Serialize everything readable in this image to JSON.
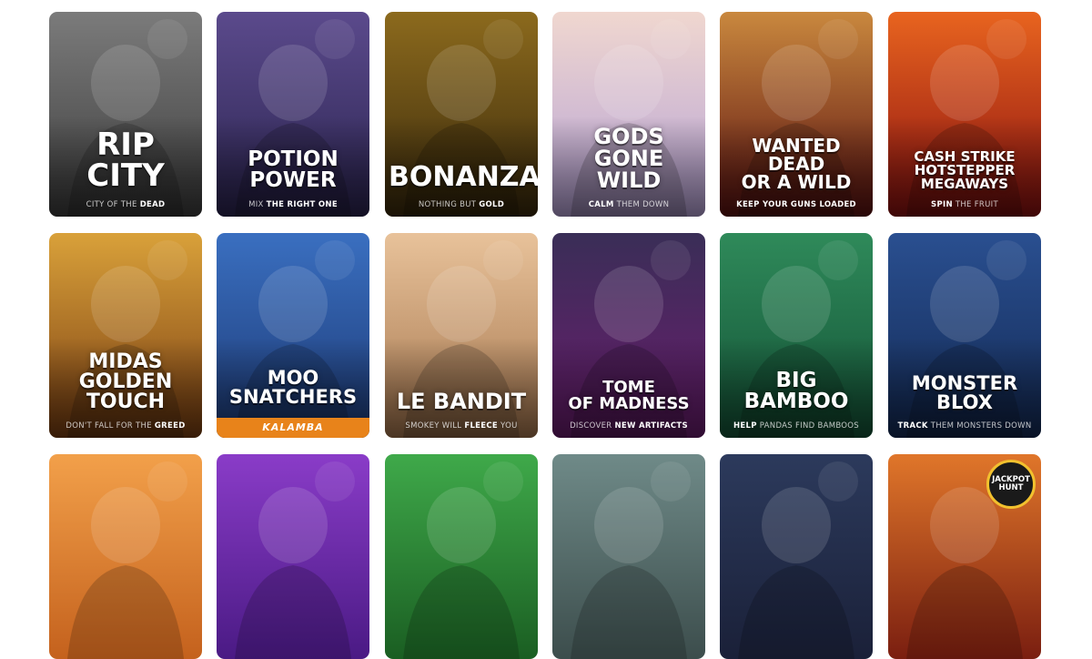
{
  "games": [
    {
      "title_lines": [
        "RIP CITY"
      ],
      "sub_pre": "CITY OF THE ",
      "sub_bold": "DEAD",
      "sub_post": "",
      "bg_top": "#7b7b7b",
      "bg_bottom": "#3d3d3d",
      "title_size": 34
    },
    {
      "title_lines": [
        "POTION POWER"
      ],
      "sub_pre": "MIX ",
      "sub_bold": "THE RIGHT ONE",
      "sub_post": "",
      "bg_top": "#5b4a8c",
      "bg_bottom": "#2b2450",
      "title_size": 23
    },
    {
      "title_lines": [
        "BONANZA"
      ],
      "sub_pre": "NOTHING BUT ",
      "sub_bold": "GOLD",
      "sub_post": "",
      "bg_top": "#8c6a1d",
      "bg_bottom": "#3a2a0c",
      "title_size": 30
    },
    {
      "title_lines": [
        "GODS GONE",
        "WILD"
      ],
      "sub_pre": "",
      "sub_bold": "CALM",
      "sub_post": " THEM DOWN",
      "bg_top": "#f0d7cf",
      "bg_bottom": "#b5a1d6",
      "title_size": 24
    },
    {
      "title_lines": [
        "WANTED DEAD",
        "OR A WILD"
      ],
      "sub_pre": "",
      "sub_bold": "KEEP YOUR GUNS LOADED",
      "sub_post": "",
      "bg_top": "#c9883e",
      "bg_bottom": "#5a1010",
      "title_size": 20
    },
    {
      "title_lines": [
        "CASH STRIKE",
        "HOTSTEPPER MEGAWAYS"
      ],
      "sub_pre": "",
      "sub_bold": "SPIN",
      "sub_post": " THE FRUIT",
      "bg_top": "#e8641f",
      "bg_bottom": "#8a1010",
      "title_size": 15
    },
    {
      "title_lines": [
        "MIDAS",
        "GOLDEN TOUCH"
      ],
      "sub_pre": "DON'T FALL FOR THE ",
      "sub_bold": "GREED",
      "sub_post": "",
      "bg_top": "#d9a13a",
      "bg_bottom": "#7a3e12",
      "title_size": 22
    },
    {
      "title_lines": [
        "MOO",
        "SNATCHERS"
      ],
      "sub_pre": "",
      "sub_bold": "",
      "sub_post": "",
      "logo_text": "KALAMBA",
      "bg_top": "#3a6fc0",
      "bg_bottom": "#1d3a76",
      "title_size": 21
    },
    {
      "title_lines": [
        "LE BANDIT"
      ],
      "sub_pre": "SMOKEY WILL ",
      "sub_bold": "FLEECE",
      "sub_post": " YOU",
      "bg_top": "#e8c29a",
      "bg_bottom": "#a5764e",
      "title_size": 24
    },
    {
      "title_lines": [
        "TOME",
        "OF MADNESS"
      ],
      "sub_pre": "DISCOVER ",
      "sub_bold": "NEW ARTIFACTS",
      "sub_post": "",
      "bg_top": "#3a2e57",
      "bg_bottom": "#6a1c6e",
      "title_size": 18
    },
    {
      "title_lines": [
        "BIG BAMBOO"
      ],
      "sub_pre": "",
      "sub_bold": "HELP",
      "sub_post": " PANDAS FIND BAMBOOS",
      "bg_top": "#2f8a5a",
      "bg_bottom": "#135236",
      "title_size": 23
    },
    {
      "title_lines": [
        "MONSTER BLOX"
      ],
      "sub_pre": "",
      "sub_bold": "TRACK",
      "sub_post": " THEM MONSTERS DOWN",
      "bg_top": "#2a4f90",
      "bg_bottom": "#132a55",
      "title_size": 21
    },
    {
      "title_lines": [],
      "sub_pre": "",
      "sub_bold": "",
      "sub_post": "",
      "bg_top": "#f2a04a",
      "bg_bottom": "#c4611d",
      "title_size": 20
    },
    {
      "title_lines": [],
      "sub_pre": "",
      "sub_bold": "",
      "sub_post": "",
      "bg_top": "#8a3cc8",
      "bg_bottom": "#4a1a84",
      "title_size": 20
    },
    {
      "title_lines": [],
      "sub_pre": "",
      "sub_bold": "",
      "sub_post": "",
      "bg_top": "#3fa94a",
      "bg_bottom": "#1a5e22",
      "title_size": 20
    },
    {
      "title_lines": [],
      "sub_pre": "",
      "sub_bold": "",
      "sub_post": "",
      "bg_top": "#6f8a88",
      "bg_bottom": "#3c4d4c",
      "title_size": 20
    },
    {
      "title_lines": [],
      "sub_pre": "",
      "sub_bold": "",
      "sub_post": "",
      "bg_top": "#2c3a5c",
      "bg_bottom": "#1a2038",
      "title_size": 20
    },
    {
      "title_lines": [],
      "badge_lines": [
        "JACKPOT",
        "HUNT"
      ],
      "sub_pre": "",
      "sub_bold": "",
      "sub_post": "",
      "bg_top": "#e0762a",
      "bg_bottom": "#7a1e10",
      "title_size": 20
    }
  ]
}
